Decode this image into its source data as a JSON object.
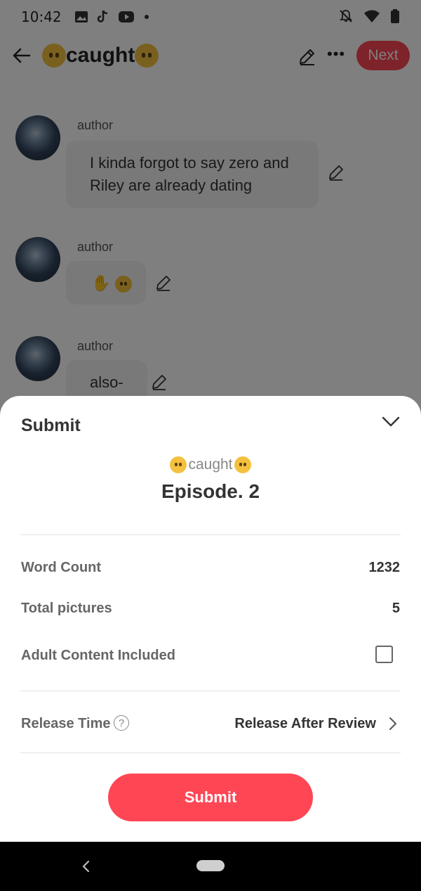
{
  "status_bar": {
    "time": "10:42"
  },
  "header": {
    "story_title": "caught",
    "next_label": "Next"
  },
  "messages": [
    {
      "author": "author",
      "text": "I kinda forgot to say zero and Riley are already dating"
    },
    {
      "author": "author",
      "text": "✋"
    },
    {
      "author": "author",
      "text": "also-"
    }
  ],
  "sheet": {
    "title": "Submit",
    "story_name": "caught",
    "episode": "Episode. 2",
    "word_count_label": "Word Count",
    "word_count_value": "1232",
    "total_pictures_label": "Total pictures",
    "total_pictures_value": "5",
    "adult_content_label": "Adult Content Included",
    "release_time_label": "Release Time",
    "release_time_help": "?",
    "release_time_value": "Release After Review",
    "submit_label": "Submit"
  },
  "colors": {
    "accent": "#ff4655",
    "overlay": "rgba(0,0,0,0.5)"
  },
  "icons": [
    "back-arrow-icon",
    "edit-pencil-icon",
    "more-icon",
    "chevron-down-icon",
    "help-icon",
    "chevron-right-icon",
    "nav-back-icon"
  ]
}
